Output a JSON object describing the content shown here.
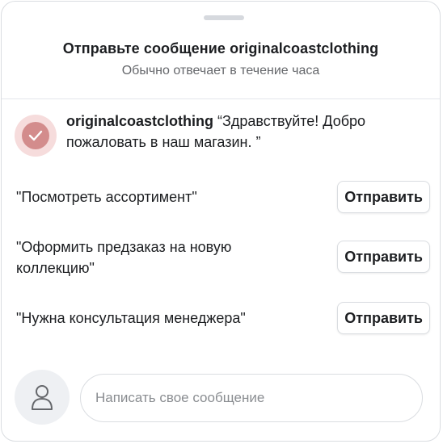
{
  "header": {
    "title": "Отправьте сообщение originalcoastclothing",
    "subtitle": "Обычно отвечает в течение часа"
  },
  "greeting": {
    "business_name": "originalcoastclothing",
    "message": "“Здравствуйте! Добро пожаловать в наш магазин. ”"
  },
  "quick_replies": [
    {
      "text": "\"Посмотреть ассортимент\"",
      "button_label": "Отправить"
    },
    {
      "text": "\"Оформить предзаказ на новую коллекцию\"",
      "button_label": "Отправить"
    },
    {
      "text": "\"Нужна консультация менеджера\"",
      "button_label": "Отправить"
    }
  ],
  "composer": {
    "placeholder": "Написать свое сообщение",
    "value": ""
  },
  "icons": {
    "business_avatar": "checkmark-icon",
    "user_avatar": "person-icon"
  },
  "colors": {
    "avatar_outer": "#f6dcdc",
    "avatar_inner": "#d38c8c",
    "border": "#dadde1",
    "secondary_text": "#65676b"
  }
}
